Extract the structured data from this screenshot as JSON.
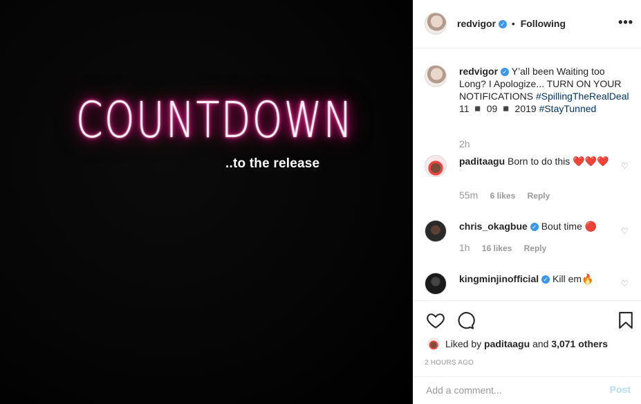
{
  "media": {
    "headline": "COUNTDOWN",
    "subline": "..to the release"
  },
  "header": {
    "username": "redvigor",
    "separator": "•",
    "follow_label": "Following",
    "more_icon": "more-options-icon"
  },
  "caption": {
    "username": "redvigor",
    "text": "Y’all been Waiting too Long? I Apologize... TURN ON YOUR NOTIFICATIONS",
    "hashtag1": "#SpillingTheRealDeal",
    "date_text": "11 ◾ 09 ◾ 2019",
    "hashtag2": "#StayTunned",
    "time": "2h"
  },
  "comments": [
    {
      "username": "paditaagu",
      "text": "Born to do this ❤️❤️❤️",
      "time": "55m",
      "likes": "6 likes",
      "reply": "Reply"
    },
    {
      "username": "chris_okagbue",
      "text": "Bout time 🔴",
      "time": "1h",
      "likes": "16 likes",
      "reply": "Reply"
    },
    {
      "username": "kingminjinofficial",
      "text": "Kill em🔥"
    }
  ],
  "actions": {
    "liked_prefix": "Liked by",
    "liked_user": "paditaagu",
    "liked_and": "and",
    "liked_count": "3,071 others",
    "posted_ago": "2 HOURS AGO"
  },
  "add_comment": {
    "placeholder": "Add a comment...",
    "post_label": "Post"
  },
  "colors": {
    "neon": "#ff1493",
    "verified": "#3897f0",
    "post_disabled": "#b2dffc"
  }
}
